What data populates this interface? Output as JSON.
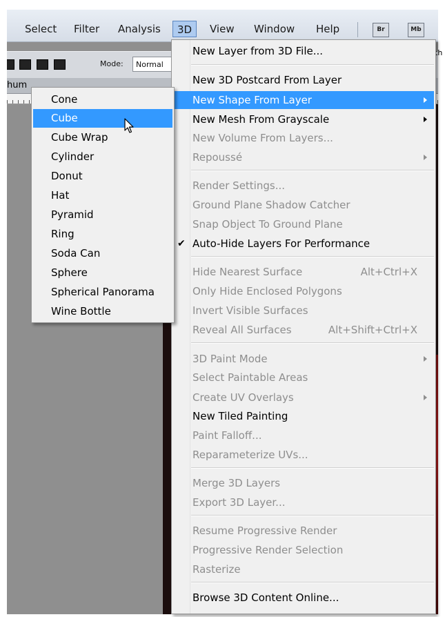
{
  "menubar": {
    "items": [
      "Select",
      "Filter",
      "Analysis",
      "3D",
      "View",
      "Window",
      "Help"
    ],
    "badges": [
      "Br",
      "Mb"
    ]
  },
  "options": {
    "mode_label": "Mode:",
    "mode_value": "Normal",
    "right_edge": "th"
  },
  "tab": {
    "label": "hum"
  },
  "menu": {
    "items": [
      {
        "label": "New Layer from 3D File...",
        "enabled": true
      },
      {
        "label": "New 3D Postcard From Layer",
        "enabled": true
      },
      {
        "label": "New Shape From Layer",
        "enabled": true,
        "submenu": true,
        "highlighted": true
      },
      {
        "label": "New Mesh From Grayscale",
        "enabled": true,
        "submenu": true
      },
      {
        "label": "New Volume From Layers...",
        "enabled": false
      },
      {
        "label": "Repoussé",
        "enabled": false,
        "submenu": true
      },
      {
        "label": "Render Settings...",
        "enabled": false
      },
      {
        "label": "Ground Plane Shadow Catcher",
        "enabled": false
      },
      {
        "label": "Snap Object To Ground Plane",
        "enabled": false
      },
      {
        "label": "Auto-Hide Layers For Performance",
        "enabled": true,
        "checked": true
      },
      {
        "label": "Hide Nearest Surface",
        "enabled": false,
        "shortcut": "Alt+Ctrl+X"
      },
      {
        "label": "Only Hide Enclosed Polygons",
        "enabled": false
      },
      {
        "label": "Invert Visible Surfaces",
        "enabled": false
      },
      {
        "label": "Reveal All Surfaces",
        "enabled": false,
        "shortcut": "Alt+Shift+Ctrl+X"
      },
      {
        "label": "3D Paint Mode",
        "enabled": false,
        "submenu": true
      },
      {
        "label": "Select Paintable Areas",
        "enabled": false
      },
      {
        "label": "Create UV Overlays",
        "enabled": false,
        "submenu": true
      },
      {
        "label": "New Tiled Painting",
        "enabled": true
      },
      {
        "label": "Paint Falloff...",
        "enabled": false
      },
      {
        "label": "Reparameterize UVs...",
        "enabled": false
      },
      {
        "label": "Merge 3D Layers",
        "enabled": false
      },
      {
        "label": "Export 3D Layer...",
        "enabled": false
      },
      {
        "label": "Resume Progressive Render",
        "enabled": false
      },
      {
        "label": "Progressive Render Selection",
        "enabled": false
      },
      {
        "label": "Rasterize",
        "enabled": false
      },
      {
        "label": "Browse 3D Content Online...",
        "enabled": true
      }
    ]
  },
  "submenu": {
    "items": [
      "Cone",
      "Cube",
      "Cube Wrap",
      "Cylinder",
      "Donut",
      "Hat",
      "Pyramid",
      "Ring",
      "Soda Can",
      "Sphere",
      "Spherical Panorama",
      "Wine Bottle"
    ],
    "highlighted": "Cube"
  },
  "colors": {
    "highlight": "#3399ff",
    "disabled_text": "#8e8e8e",
    "menu_bg": "#f0f0f0"
  }
}
